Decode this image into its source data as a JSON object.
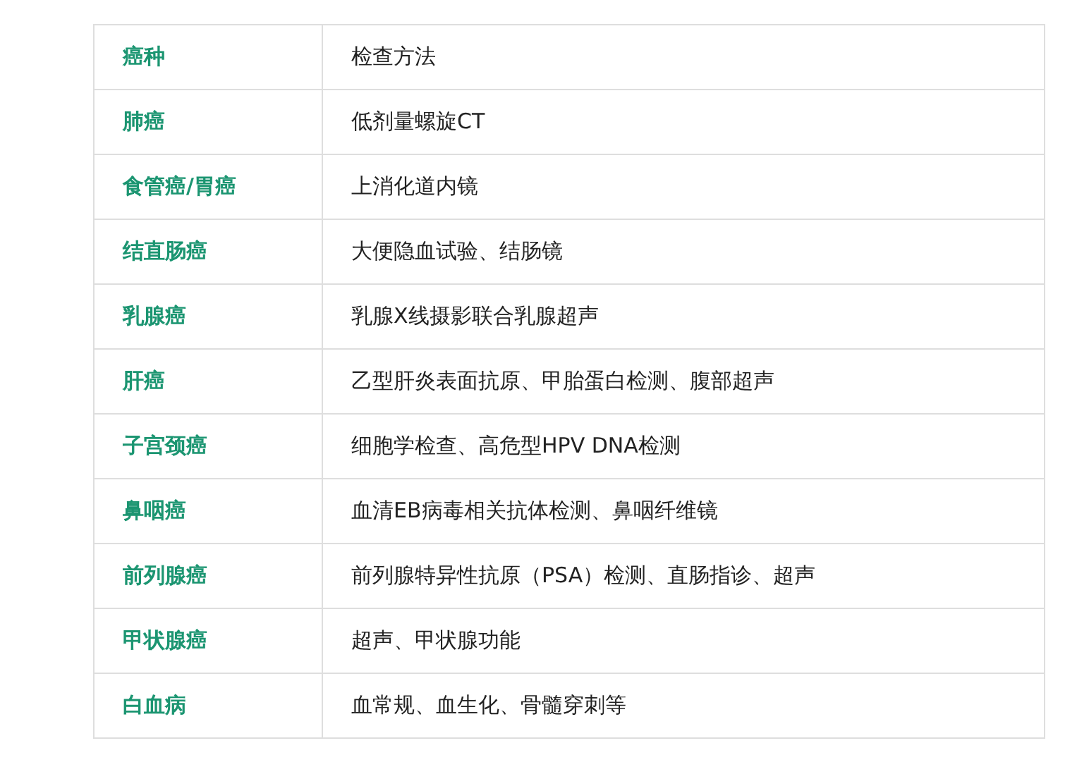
{
  "table": {
    "columns": [
      "癌种",
      "检查方法"
    ],
    "rows": [
      {
        "cancer": "肺癌",
        "method": "低剂量螺旋CT"
      },
      {
        "cancer": "食管癌/胃癌",
        "method": "上消化道内镜"
      },
      {
        "cancer": "结直肠癌",
        "method": "大便隐血试验、结肠镜"
      },
      {
        "cancer": "乳腺癌",
        "method": "乳腺X线摄影联合乳腺超声"
      },
      {
        "cancer": "肝癌",
        "method": "乙型肝炎表面抗原、甲胎蛋白检测、腹部超声"
      },
      {
        "cancer": "子宫颈癌",
        "method": "细胞学检查、高危型HPV DNA检测"
      },
      {
        "cancer": "鼻咽癌",
        "method": "血清EB病毒相关抗体检测、鼻咽纤维镜"
      },
      {
        "cancer": "前列腺癌",
        "method": "前列腺特异性抗原（PSA）检测、直肠指诊、超声"
      },
      {
        "cancer": "甲状腺癌",
        "method": "超声、甲状腺功能"
      },
      {
        "cancer": "白血病",
        "method": "血常规、血生化、骨髓穿刺等"
      }
    ]
  }
}
